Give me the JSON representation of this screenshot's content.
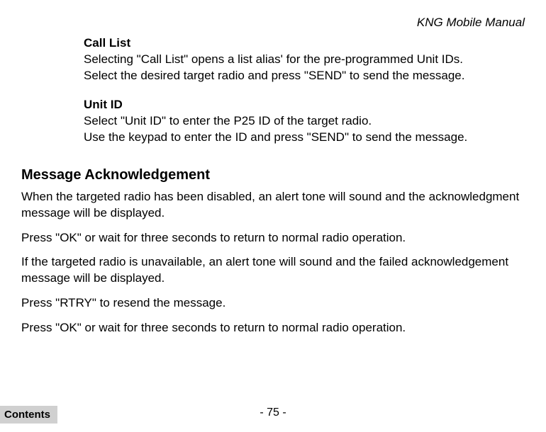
{
  "header": {
    "title": "KNG Mobile Manual"
  },
  "sections": {
    "callList": {
      "heading": "Call List",
      "line1": "Selecting \"Call List\" opens a list alias' for the pre-programmed Unit IDs.",
      "line2": "Select the desired target radio and press \"SEND\" to send the message."
    },
    "unitId": {
      "heading": "Unit ID",
      "line1": "Select \"Unit ID\" to enter the P25 ID of the target radio.",
      "line2": "Use the keypad to enter the ID and press \"SEND\" to send the message."
    },
    "messageAck": {
      "heading": "Message Acknowledgement",
      "p1": "When the targeted radio has been disabled, an alert tone will sound and the acknowledgment message will be displayed.",
      "p2": "Press \"OK\" or wait for three seconds to return to normal radio operation.",
      "p3": "If the targeted radio is unavailable, an alert tone will sound and the failed acknowledgement message will be displayed.",
      "p4": "Press \"RTRY\" to resend the message.",
      "p5": "Press \"OK\" or wait for three seconds to return to normal radio operation."
    }
  },
  "footer": {
    "pageNumber": "- 75 -",
    "contentsLabel": "Contents"
  }
}
